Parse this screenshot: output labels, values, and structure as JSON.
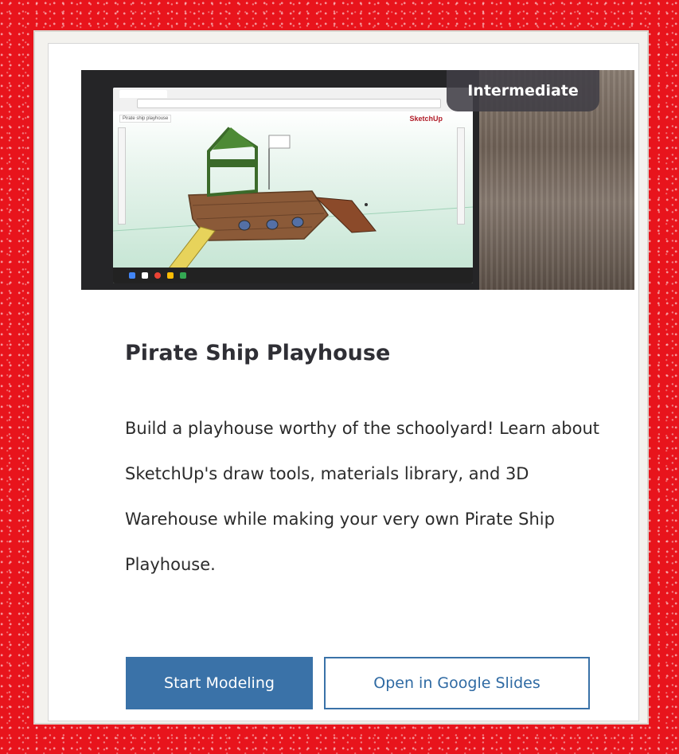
{
  "card": {
    "level_badge": "Intermediate",
    "title": "Pirate Ship Playhouse",
    "description": "Build a playhouse worthy of the schoolyard! Learn about SketchUp's draw tools, materials library, and 3D Warehouse while making your very own Pirate Ship Playhouse.",
    "primary_button_label": "Start Modeling",
    "secondary_button_label": "Open in Google Slides"
  },
  "image": {
    "screen_app_logo": "SketchUp",
    "screen_model_tab": "Pirate ship playhouse",
    "icon_names": [
      "laptop-screen-image",
      "sketchup-logo-icon",
      "pirate-ship-model-icon"
    ]
  },
  "colors": {
    "frame_red": "#e8141c",
    "primary_button": "#3a72a8",
    "badge_bg": "#403e46",
    "title_text": "#2f2f35"
  }
}
